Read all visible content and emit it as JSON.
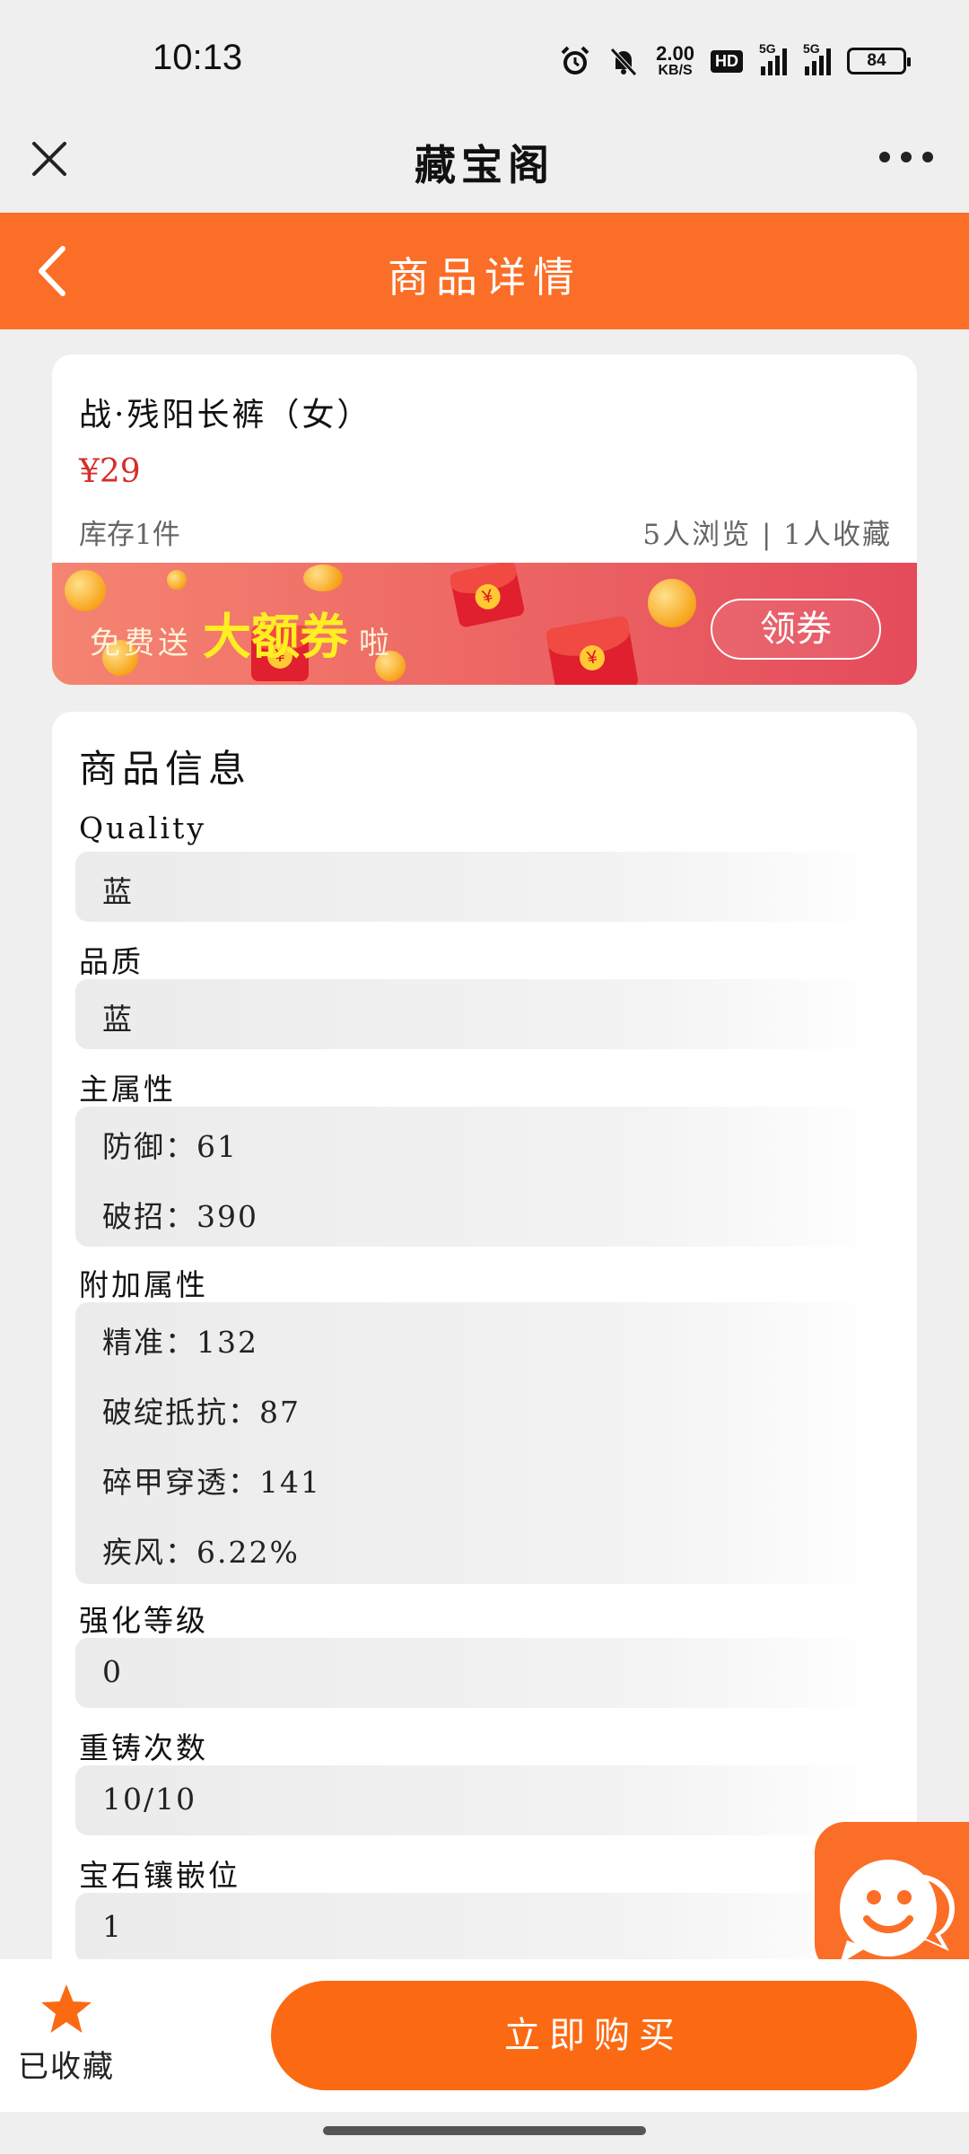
{
  "status_bar": {
    "time": "10:13",
    "net_speed_value": "2.00",
    "net_speed_unit": "KB/S",
    "hd_label": "HD",
    "signal1": "5G",
    "signal2": "5G",
    "battery": "84"
  },
  "mini_program": {
    "title": "藏宝阁"
  },
  "page_header": {
    "title": "商品详情"
  },
  "product": {
    "name": "战·残阳长裤（女）",
    "price": "¥29",
    "stock": "库存1件",
    "stats": "5人浏览 | 1人收藏"
  },
  "coupon_banner": {
    "pre_text": "免费送",
    "highlight": "大额券",
    "post_text": "啦",
    "button_label": "领券"
  },
  "info": {
    "title": "商品信息",
    "fields": [
      {
        "label": "Quality",
        "values": [
          "蓝"
        ]
      },
      {
        "label": "品质",
        "values": [
          "蓝"
        ]
      },
      {
        "label": "主属性",
        "values": [
          "防御：61",
          "破招：390"
        ]
      },
      {
        "label": "附加属性",
        "values": [
          "精准：132",
          "破绽抵抗：87",
          "碎甲穿透：141",
          "疾风：6.22%"
        ]
      },
      {
        "label": "强化等级",
        "values": [
          "0"
        ]
      },
      {
        "label": "重铸次数",
        "values": [
          "10/10"
        ]
      },
      {
        "label": "宝石镶嵌位",
        "values": [
          "1"
        ]
      }
    ]
  },
  "bottom_bar": {
    "favorite_label": "已收藏",
    "buy_label": "立即购买"
  },
  "colors": {
    "brand_orange": "#fb6e27",
    "buy_button": "#fb6a13",
    "price_red": "#d62d2d",
    "coupon_yellow": "#ffee22"
  },
  "icons": {
    "close": "close-icon",
    "more": "more-icon",
    "back": "back-icon",
    "favorite": "star-icon",
    "chat": "chat-icon"
  }
}
